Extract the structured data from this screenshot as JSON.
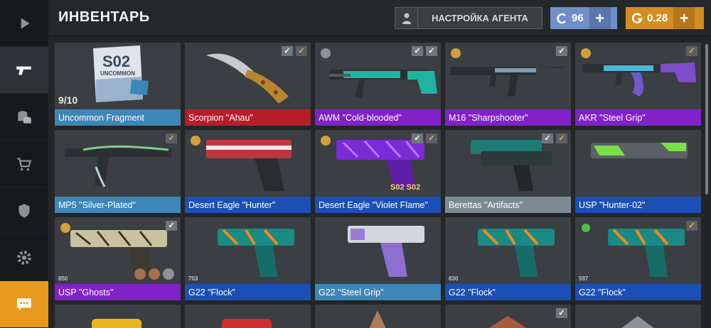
{
  "header": {
    "title": "ИНВЕНТАРЬ",
    "agent_button_label": "НАСТРОЙКА АГЕНТА",
    "credits": {
      "value": "96",
      "plus": "+"
    },
    "gold": {
      "value": "0.28",
      "plus": "+"
    }
  },
  "sidebar": [
    {
      "name": "play",
      "icon": "play-icon"
    },
    {
      "name": "weapons",
      "icon": "pistol-icon",
      "active": true
    },
    {
      "name": "coins",
      "icon": "coins-icon"
    },
    {
      "name": "shop",
      "icon": "cart-icon"
    },
    {
      "name": "clan",
      "icon": "shield-icon"
    },
    {
      "name": "settings",
      "icon": "gear-icon"
    },
    {
      "name": "chat",
      "icon": "chat-icon"
    }
  ],
  "fragment": {
    "art_text_top": "S02",
    "art_text_label": "UNCOMMON",
    "count": "9/10"
  },
  "items": [
    {
      "name": "Uncommon Fragment",
      "rarity": "uncommon",
      "checks": []
    },
    {
      "name": "Scorpion \"Ahau\"",
      "rarity": "legend",
      "checks": [
        "grey",
        "gold"
      ]
    },
    {
      "name": "AWM \"Cold-blooded\"",
      "rarity": "epic",
      "checks": [
        "grey",
        "grey"
      ]
    },
    {
      "name": "M16 \"Sharpshooter\"",
      "rarity": "epic",
      "checks": [
        "grey"
      ]
    },
    {
      "name": "AKR \"Steel Grip\"",
      "rarity": "epic",
      "checks": [
        "gold"
      ]
    },
    {
      "name": "MP5 \"Silver-Plated\"",
      "rarity": "uncommon",
      "checks": [
        "gold"
      ]
    },
    {
      "name": "Desert Eagle \"Hunter\"",
      "rarity": "rare",
      "checks": []
    },
    {
      "name": "Desert Eagle \"Violet Flame\"",
      "rarity": "rare",
      "checks": [
        "grey",
        "gold"
      ]
    },
    {
      "name": "Berettas \"Artifacts\"",
      "rarity": "common",
      "checks": [
        "grey",
        "gold"
      ]
    },
    {
      "name": "USP \"Hunter-02\"",
      "rarity": "rare",
      "checks": []
    },
    {
      "name": "USP \"Ghosts\"",
      "rarity": "epic",
      "checks": [
        "grey"
      ]
    },
    {
      "name": "G22 \"Flock\"",
      "rarity": "rare",
      "checks": []
    },
    {
      "name": "G22 \"Steel Grip\"",
      "rarity": "uncommon",
      "checks": []
    },
    {
      "name": "G22 \"Flock\"",
      "rarity": "rare",
      "checks": []
    },
    {
      "name": "G22 \"Flock\"",
      "rarity": "rare",
      "checks": [
        "gold"
      ]
    }
  ],
  "card_badges": {
    "usp_ghosts": "850",
    "g22_flock_1": "703",
    "g22_flock_2": "830",
    "g22_flock_3": "597",
    "violet_flame_stickers": "S02 S02"
  },
  "colors": {
    "uncommon": "#3d86b8",
    "rare": "#1c4fb5",
    "epic": "#8121c8",
    "legend": "#b81d2a",
    "common": "#7a8b94",
    "gold_accent": "#d38e22",
    "credits_accent": "#6f8fc9"
  }
}
